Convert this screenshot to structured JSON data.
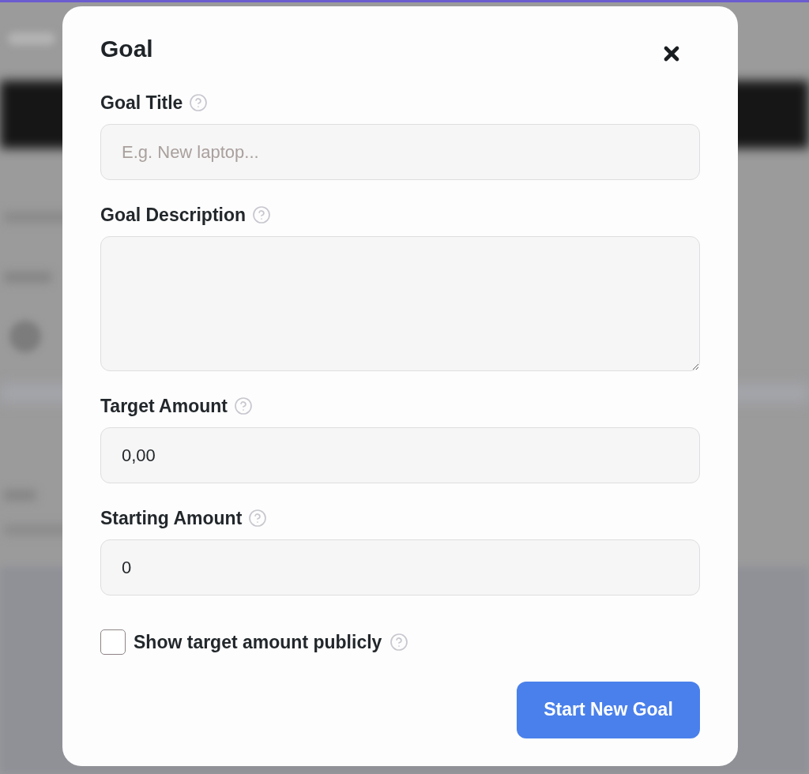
{
  "dialog": {
    "title": "Goal",
    "fields": [
      {
        "kind": "text",
        "label": "Goal Title",
        "placeholder": "E.g. New laptop..."
      },
      {
        "kind": "textarea",
        "label": "Goal Description"
      },
      {
        "kind": "text",
        "label": "Target Amount",
        "value": "0,00"
      },
      {
        "kind": "text",
        "label": "Starting Amount",
        "value": "0"
      }
    ],
    "checkbox": {
      "label": "Show target amount publicly",
      "checked": false
    },
    "submit_button": {
      "label": "Start New Goal"
    }
  }
}
